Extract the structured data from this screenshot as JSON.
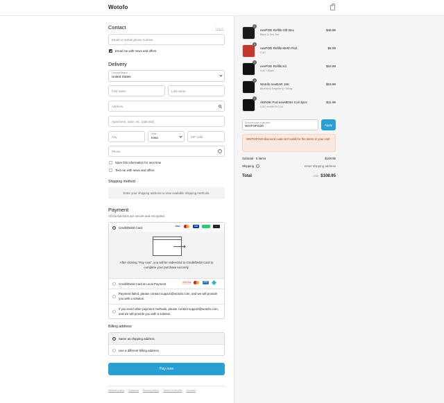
{
  "header": {
    "brand": "Wotofo",
    "cart_icon": "shopping-bag-icon"
  },
  "contact": {
    "title": "Contact",
    "login_link": "Log in",
    "email_placeholder": "Email or mobile phone number",
    "email_news_label": "Email me with news and offers",
    "email_news_checked": true
  },
  "delivery": {
    "title": "Delivery",
    "country_label": "Country/Region",
    "country_value": "United States",
    "first_name_placeholder": "First name",
    "last_name_placeholder": "Last name",
    "address_placeholder": "Address",
    "apartment_placeholder": "Apartment, suite, etc. (optional)",
    "city_placeholder": "City",
    "state_label": "State",
    "state_value": "Iowa",
    "zip_placeholder": "ZIP code",
    "phone_placeholder": "Phone",
    "save_info_label": "Save this information for next time",
    "text_news_label": "Text me with news and offers"
  },
  "shipping_method": {
    "title": "Shipping method",
    "message": "Enter your shipping address to view available shipping methods."
  },
  "payment": {
    "title": "Payment",
    "subtitle": "All transactions are secure and encrypted.",
    "option_card": "Credit/Debit Card",
    "card_logos": [
      "VISA",
      "MC",
      "JCB",
      "",
      "···"
    ],
    "redirect_text": "After clicking \"Pay now\", you will be redirected to Credit/Debit Card to complete your purchase securely.",
    "option_card_local": "Credit/Debit Card & Local Payment",
    "local_logos": [
      "DISCOVER",
      "MC",
      "AMEX",
      ""
    ],
    "failed_text": "Payment failed, please contact support@wotofo.com, and we will provide you with a solution.",
    "other_text": "If you need other payment methods, please contact support@wotofo.com, and we will provide you with a solution."
  },
  "billing": {
    "title": "Billing address",
    "same": "Same as shipping address",
    "different": "Use a different billing address"
  },
  "pay_button": "Pay now",
  "footer": [
    "Refund policy",
    "Shipping",
    "Privacy policy",
    "Terms of service",
    "Contact"
  ],
  "cart": {
    "items": [
      {
        "qty": "1",
        "name": "nexPOD Refills Gift Box",
        "variant": "Black & Red Set",
        "price": "$49.99"
      },
      {
        "qty": "1",
        "name": "nexPOD Refills Mesh Pod",
        "variant": "0.4Ω",
        "price": "$9.99"
      },
      {
        "qty": "1",
        "name": "nexPOD Refills Kit",
        "variant": "0.8Ω / Black",
        "price": "$16.99"
      },
      {
        "qty": "1",
        "name": "Wotofo nexBAR 16K",
        "variant": "Blueberry Raspberry / 50mg",
        "price": "$19.99"
      },
      {
        "qty": "1",
        "name": "AEROK Pod nexMESH Coil 3pcs",
        "variant": "0.8Ω nexMESH Coil",
        "price": "$11.99"
      }
    ],
    "discount_label": "Discount code or gift card",
    "discount_value": "WOTOFO20",
    "apply_label": "Apply",
    "warning": "WOTOFO20 discount code isn't valid for the items in your cart",
    "subtotal_label": "Subtotal · 5 items",
    "subtotal_value": "$108.95",
    "shipping_label": "Shipping",
    "shipping_value": "Enter shipping address",
    "total_label": "Total",
    "currency": "USD",
    "total_value": "$108.95"
  }
}
